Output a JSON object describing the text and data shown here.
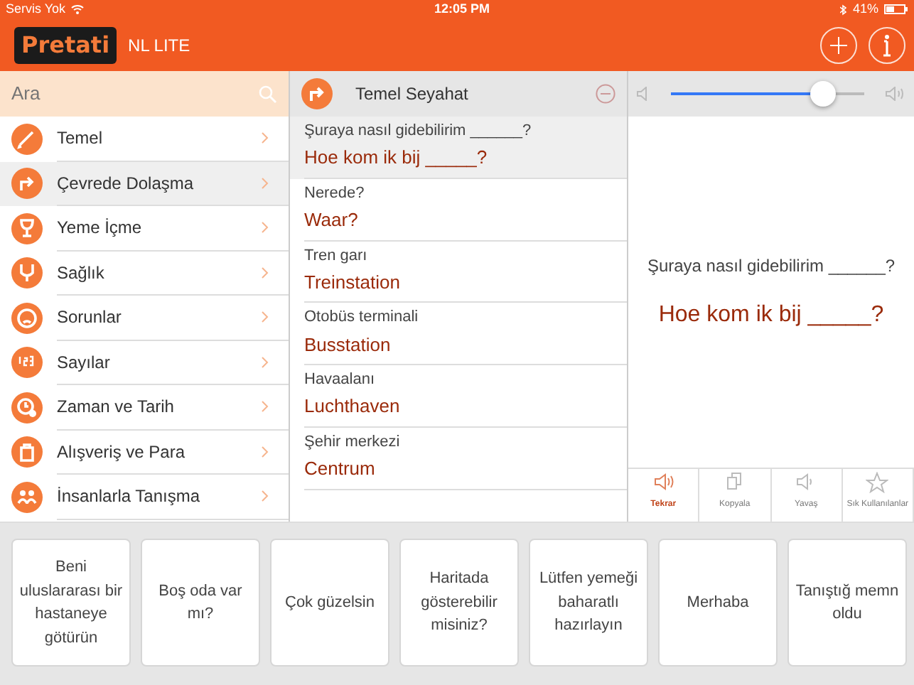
{
  "status_bar": {
    "carrier": "Servis Yok",
    "time": "12:05 PM",
    "battery": "41%"
  },
  "header": {
    "logo": "Pretati",
    "subtitle": "NL LITE"
  },
  "search": {
    "placeholder": "Ara"
  },
  "categories": [
    {
      "label": "Temel",
      "selected": false
    },
    {
      "label": "Çevrede Dolaşma",
      "selected": true
    },
    {
      "label": "Yeme İçme",
      "selected": false
    },
    {
      "label": "Sağlık",
      "selected": false
    },
    {
      "label": "Sorunlar",
      "selected": false
    },
    {
      "label": "Sayılar",
      "selected": false
    },
    {
      "label": "Zaman ve Tarih",
      "selected": false
    },
    {
      "label": "Alışveriş ve Para",
      "selected": false
    },
    {
      "label": "İnsanlarla Tanışma",
      "selected": false
    }
  ],
  "phrase_list": {
    "title": "Temel Seyahat",
    "items": [
      {
        "source": "Şuraya nasıl gidebilirim ______?",
        "target": "Hoe kom ik bij _____?",
        "selected": true
      },
      {
        "source": "Nerede?",
        "target": "Waar?",
        "selected": false
      },
      {
        "source": "Tren garı",
        "target": "Treinstation",
        "selected": false
      },
      {
        "source": "Otobüs terminali",
        "target": "Busstation",
        "selected": false
      },
      {
        "source": "Havaalanı",
        "target": "Luchthaven",
        "selected": false
      },
      {
        "source": "Şehir merkezi",
        "target": "Centrum",
        "selected": false
      }
    ]
  },
  "player": {
    "volume": {
      "level": 0.79
    },
    "source": "Şuraya nasıl gidebilirim ______?",
    "target": "Hoe kom ik bij _____?",
    "actions": [
      {
        "label": "Tekrar",
        "selected": true
      },
      {
        "label": "Kopyala",
        "selected": false
      },
      {
        "label": "Yavaş",
        "selected": false
      },
      {
        "label": "Sık Kullanılanlar",
        "selected": false
      }
    ]
  },
  "suggestions": [
    "Beni uluslararası bir hastaneye götürün",
    "Boş oda var mı?",
    "Çok güzelsin",
    "Haritada gösterebilir misiniz?",
    "Lütfen yemeği baharatlı hazırlayın",
    "Merhaba",
    "Tanıştığ memn oldu"
  ]
}
